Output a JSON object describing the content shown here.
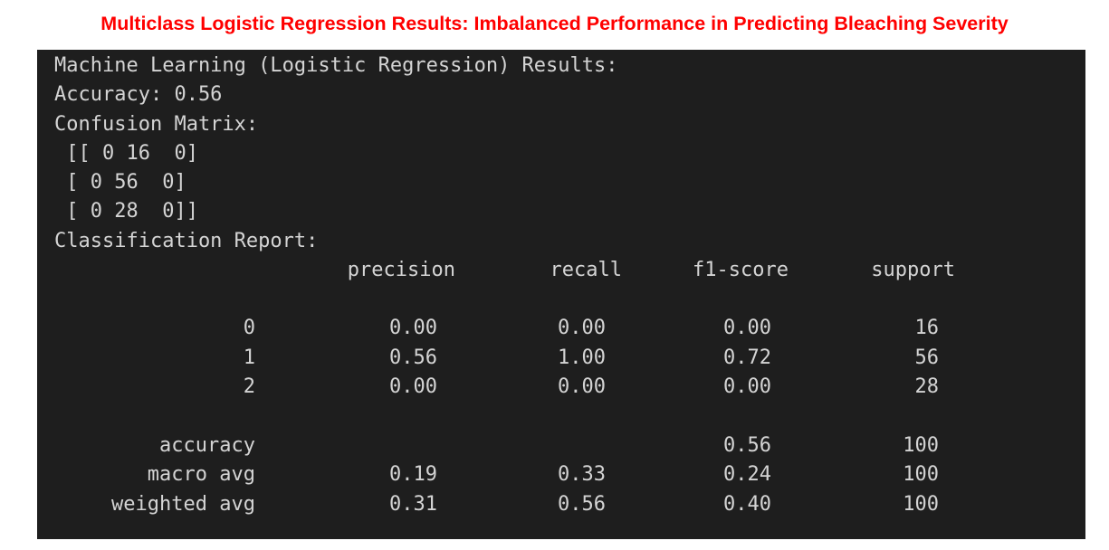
{
  "caption": "Multiclass Logistic Regression Results: Imbalanced Performance in Predicting Bleaching Severity",
  "terminal": {
    "heading": "Machine Learning (Logistic Regression) Results:",
    "accuracy_line": "Accuracy: 0.56",
    "confusion_title": "Confusion Matrix:",
    "confusion_rows": [
      " [[ 0 16  0]",
      " [ 0 56  0]",
      " [ 0 28  0]]"
    ],
    "report_title": "Classification Report:",
    "report_columns": [
      "precision",
      "recall",
      "f1-score",
      "support"
    ],
    "report_rows": [
      {
        "label": "0",
        "precision": "0.00",
        "recall": "0.00",
        "f1": "0.00",
        "support": "16"
      },
      {
        "label": "1",
        "precision": "0.56",
        "recall": "1.00",
        "f1": "0.72",
        "support": "56"
      },
      {
        "label": "2",
        "precision": "0.00",
        "recall": "0.00",
        "f1": "0.00",
        "support": "28"
      }
    ],
    "summary_rows": [
      {
        "label": "accuracy",
        "precision": "",
        "recall": "",
        "f1": "0.56",
        "support": "100"
      },
      {
        "label": "macro avg",
        "precision": "0.19",
        "recall": "0.33",
        "f1": "0.24",
        "support": "100"
      },
      {
        "label": "weighted avg",
        "precision": "0.31",
        "recall": "0.56",
        "f1": "0.40",
        "support": "100"
      }
    ]
  },
  "colors": {
    "caption": "#ff0000",
    "terminal_bg": "#1e1e1e",
    "terminal_text": "#d4d4d4"
  }
}
